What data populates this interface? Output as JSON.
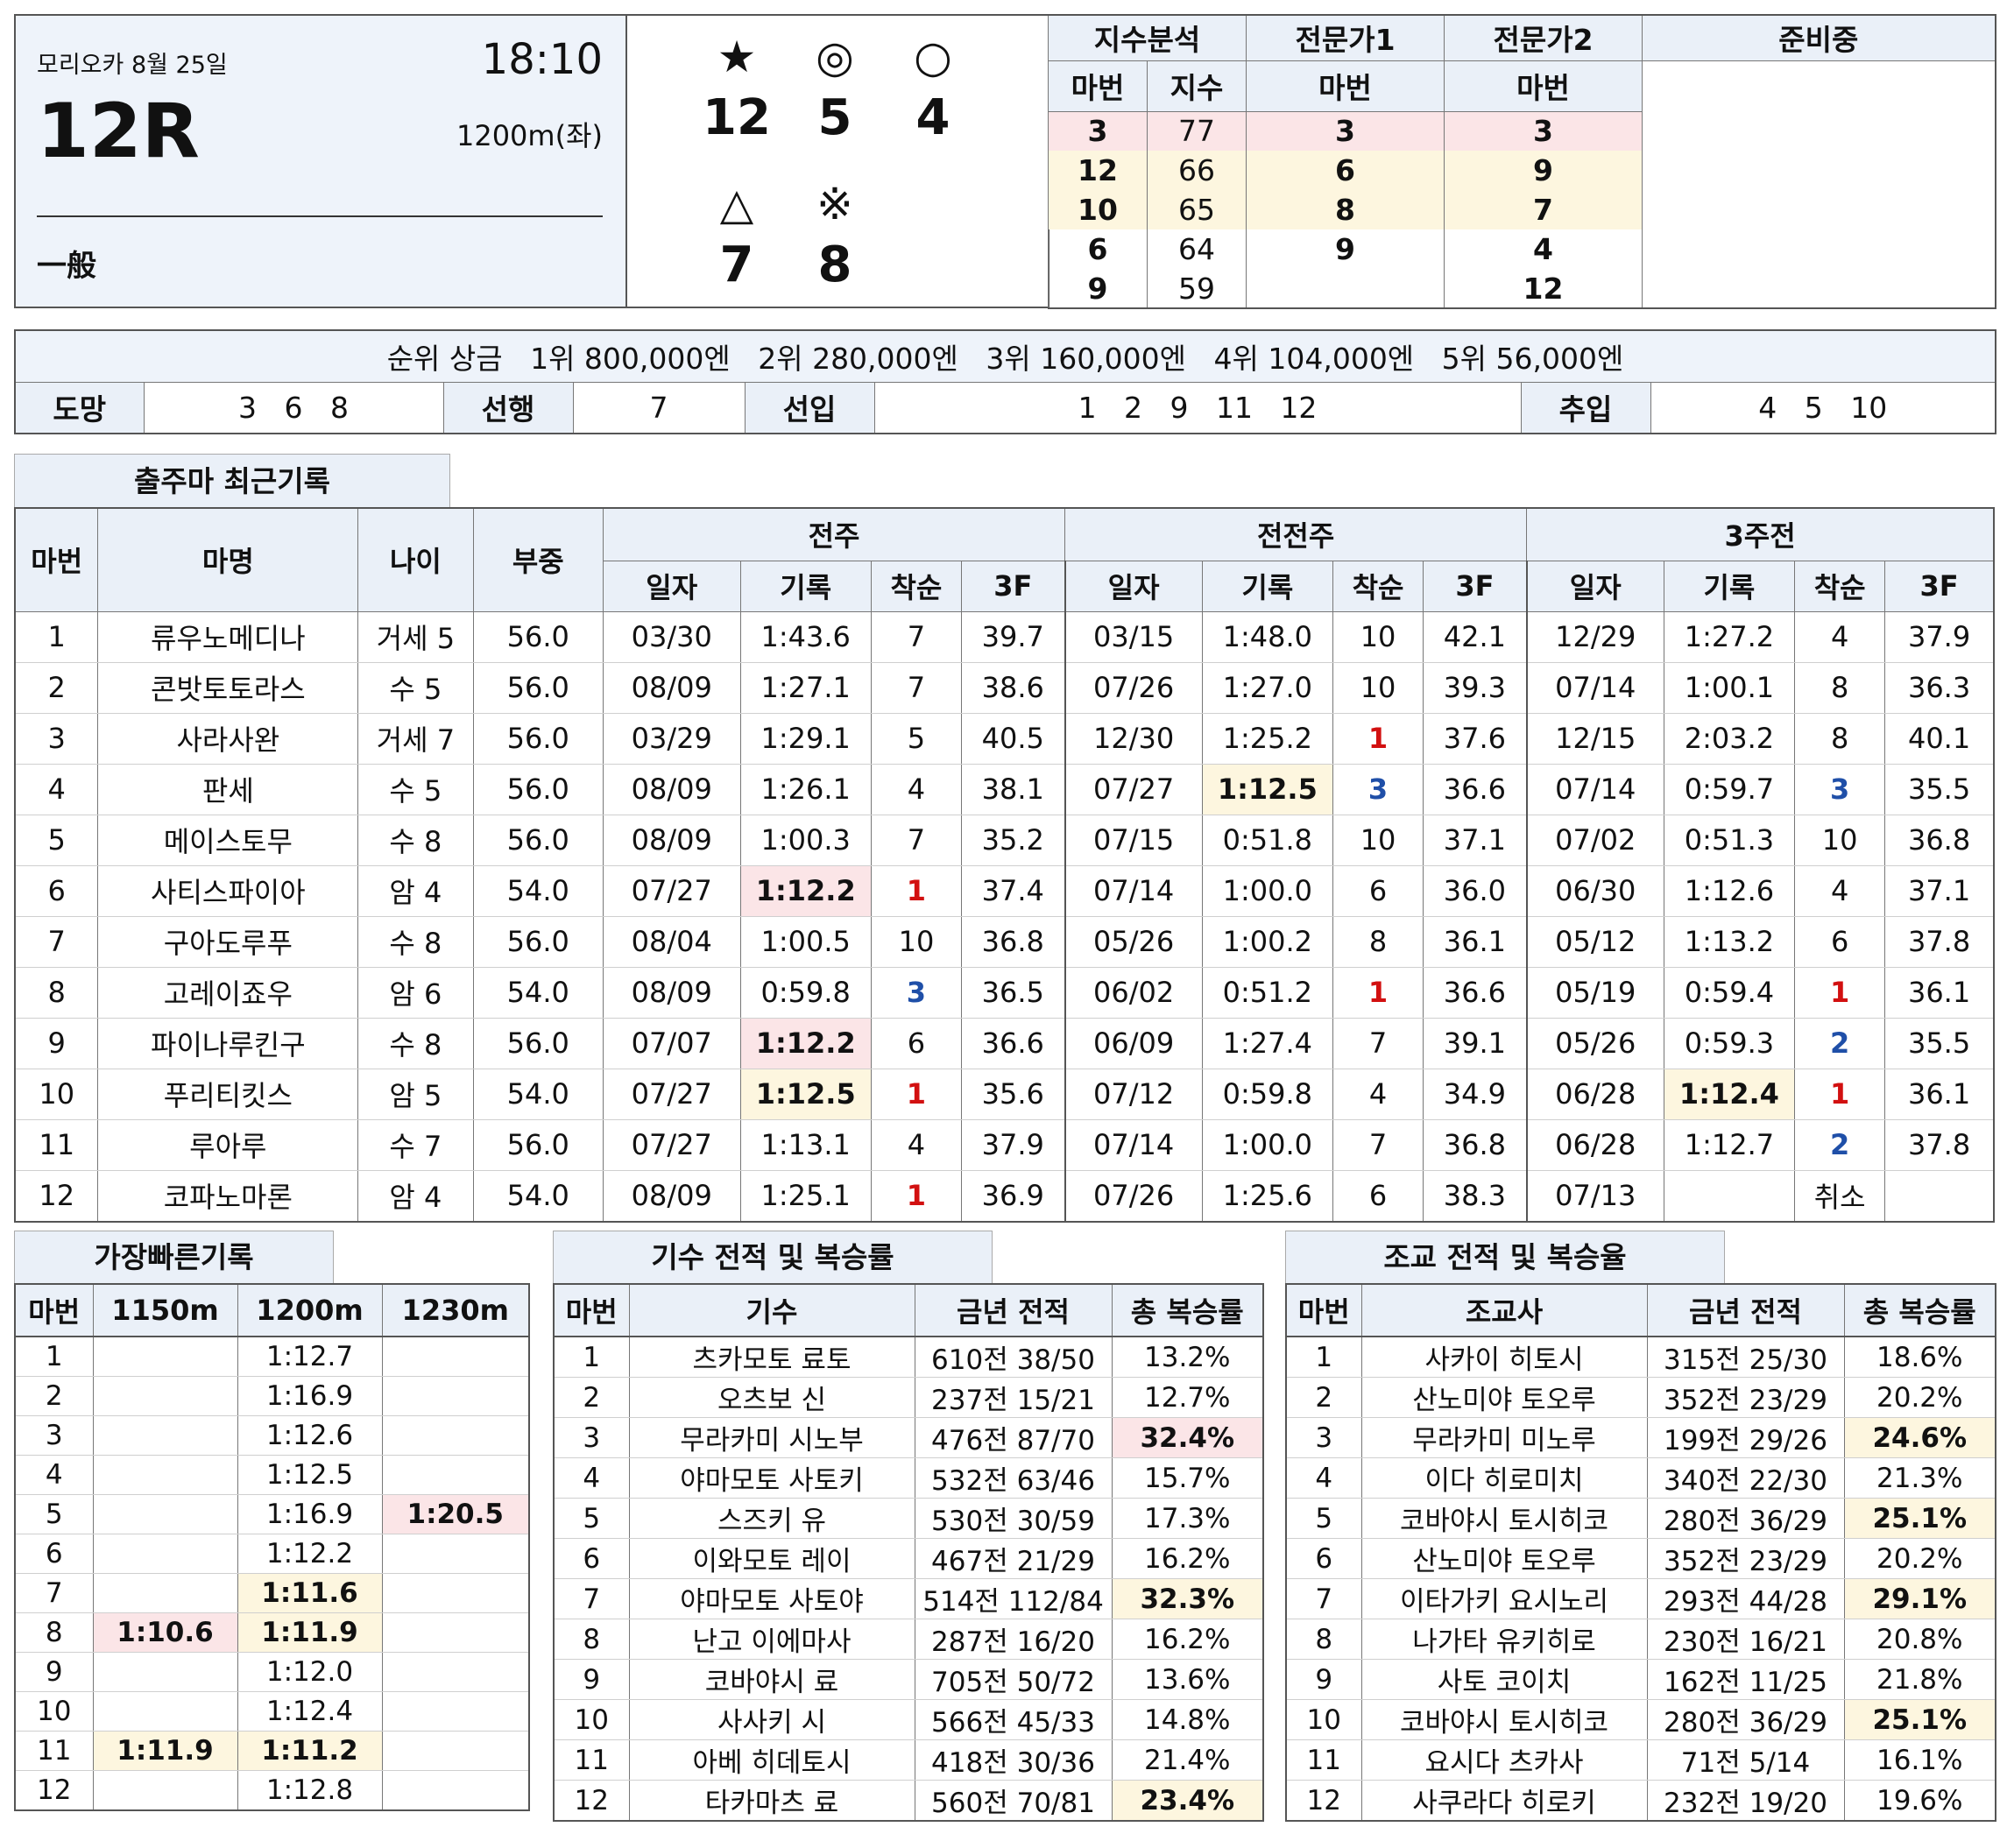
{
  "race": {
    "venue_date": "모리오카 8월 25일",
    "time": "18:10",
    "number": "12R",
    "distance": "1200m(좌)",
    "class": "一般"
  },
  "marks": [
    {
      "symbol": "★",
      "num": "12"
    },
    {
      "symbol": "◎",
      "num": "5"
    },
    {
      "symbol": "○",
      "num": "4"
    },
    {
      "symbol": "△",
      "num": "7"
    },
    {
      "symbol": "※",
      "num": "8"
    }
  ],
  "analysis": {
    "headers": [
      "지수분석",
      "전문가1",
      "전문가2",
      "준비중"
    ],
    "subheaders": [
      "마번",
      "지수",
      "마번",
      "마번"
    ],
    "rows": [
      {
        "idx_num": "3",
        "idx_val": "77",
        "exp1": "3",
        "exp2": "3"
      },
      {
        "idx_num": "12",
        "idx_val": "66",
        "exp1": "6",
        "exp2": "9"
      },
      {
        "idx_num": "10",
        "idx_val": "65",
        "exp1": "8",
        "exp2": "7"
      },
      {
        "idx_num": "6",
        "idx_val": "64",
        "exp1": "9",
        "exp2": "4"
      },
      {
        "idx_num": "9",
        "idx_val": "59",
        "exp1": "",
        "exp2": "12"
      }
    ]
  },
  "prize": {
    "text": "순위 상금   1위 800,000엔   2위 280,000엔   3위 160,000엔   4위 104,000엔   5위 56,000엔"
  },
  "style": {
    "labels": [
      "도망",
      "선행",
      "선입",
      "추입"
    ],
    "values": [
      "3   6   8",
      "7",
      "1   2   9   11   12",
      "4   5   10"
    ]
  },
  "recent": {
    "title": "출주마 최근기록",
    "headers": [
      "마번",
      "마명",
      "나이",
      "부중"
    ],
    "groups": [
      "전주",
      "전전주",
      "3주전"
    ],
    "sub": [
      "일자",
      "기록",
      "착순",
      "3F"
    ],
    "rows": [
      {
        "num": "1",
        "name": "류우노메디나",
        "age": "거세 5",
        "wt": "56.0",
        "r": [
          [
            "03/30",
            "1:43.6",
            "7",
            "39.7"
          ],
          [
            "03/15",
            "1:48.0",
            "10",
            "42.1"
          ],
          [
            "12/29",
            "1:27.2",
            "4",
            "37.9"
          ]
        ]
      },
      {
        "num": "2",
        "name": "콘밧토토라스",
        "age": "수 5",
        "wt": "56.0",
        "r": [
          [
            "08/09",
            "1:27.1",
            "7",
            "38.6"
          ],
          [
            "07/26",
            "1:27.0",
            "10",
            "39.3"
          ],
          [
            "07/14",
            "1:00.1",
            "8",
            "36.3"
          ]
        ]
      },
      {
        "num": "3",
        "name": "사라사완",
        "age": "거세 7",
        "wt": "56.0",
        "r": [
          [
            "03/29",
            "1:29.1",
            "5",
            "40.5"
          ],
          [
            "12/30",
            "1:25.2",
            "1",
            "37.6"
          ],
          [
            "12/15",
            "2:03.2",
            "8",
            "40.1"
          ]
        ]
      },
      {
        "num": "4",
        "name": "판세",
        "age": "수 5",
        "wt": "56.0",
        "r": [
          [
            "08/09",
            "1:26.1",
            "4",
            "38.1"
          ],
          [
            "07/27",
            "1:12.5",
            "3",
            "36.6"
          ],
          [
            "07/14",
            "0:59.7",
            "3",
            "35.5"
          ]
        ]
      },
      {
        "num": "5",
        "name": "메이스토무",
        "age": "수 8",
        "wt": "56.0",
        "r": [
          [
            "08/09",
            "1:00.3",
            "7",
            "35.2"
          ],
          [
            "07/15",
            "0:51.8",
            "10",
            "37.1"
          ],
          [
            "07/02",
            "0:51.3",
            "10",
            "36.8"
          ]
        ]
      },
      {
        "num": "6",
        "name": "사티스파이아",
        "age": "암 4",
        "wt": "54.0",
        "r": [
          [
            "07/27",
            "1:12.2",
            "1",
            "37.4"
          ],
          [
            "07/14",
            "1:00.0",
            "6",
            "36.0"
          ],
          [
            "06/30",
            "1:12.6",
            "4",
            "37.1"
          ]
        ]
      },
      {
        "num": "7",
        "name": "구아도루푸",
        "age": "수 8",
        "wt": "56.0",
        "r": [
          [
            "08/04",
            "1:00.5",
            "10",
            "36.8"
          ],
          [
            "05/26",
            "1:00.2",
            "8",
            "36.1"
          ],
          [
            "05/12",
            "1:13.2",
            "6",
            "37.8"
          ]
        ]
      },
      {
        "num": "8",
        "name": "고레이죠우",
        "age": "암 6",
        "wt": "54.0",
        "r": [
          [
            "08/09",
            "0:59.8",
            "3",
            "36.5"
          ],
          [
            "06/02",
            "0:51.2",
            "1",
            "36.6"
          ],
          [
            "05/19",
            "0:59.4",
            "1",
            "36.1"
          ]
        ]
      },
      {
        "num": "9",
        "name": "파이나루킨구",
        "age": "수 8",
        "wt": "56.0",
        "r": [
          [
            "07/07",
            "1:12.2",
            "6",
            "36.6"
          ],
          [
            "06/09",
            "1:27.4",
            "7",
            "39.1"
          ],
          [
            "05/26",
            "0:59.3",
            "2",
            "35.5"
          ]
        ]
      },
      {
        "num": "10",
        "name": "푸리티킷스",
        "age": "암 5",
        "wt": "54.0",
        "r": [
          [
            "07/27",
            "1:12.5",
            "1",
            "35.6"
          ],
          [
            "07/12",
            "0:59.8",
            "4",
            "34.9"
          ],
          [
            "06/28",
            "1:12.4",
            "1",
            "36.1"
          ]
        ]
      },
      {
        "num": "11",
        "name": "루아루",
        "age": "수 7",
        "wt": "56.0",
        "r": [
          [
            "07/27",
            "1:13.1",
            "4",
            "37.9"
          ],
          [
            "07/14",
            "1:00.0",
            "7",
            "36.8"
          ],
          [
            "06/28",
            "1:12.7",
            "2",
            "37.8"
          ]
        ]
      },
      {
        "num": "12",
        "name": "코파노마론",
        "age": "암 4",
        "wt": "54.0",
        "r": [
          [
            "08/09",
            "1:25.1",
            "1",
            "36.9"
          ],
          [
            "07/26",
            "1:25.6",
            "6",
            "38.3"
          ],
          [
            "07/13",
            "",
            "취소",
            ""
          ]
        ]
      }
    ]
  },
  "fastest": {
    "title": "가장빠른기록",
    "headers": [
      "마번",
      "1150m",
      "1200m",
      "1230m"
    ],
    "rows": [
      [
        "1",
        "",
        "1:12.7",
        ""
      ],
      [
        "2",
        "",
        "1:16.9",
        ""
      ],
      [
        "3",
        "",
        "1:12.6",
        ""
      ],
      [
        "4",
        "",
        "1:12.5",
        ""
      ],
      [
        "5",
        "",
        "1:16.9",
        "1:20.5"
      ],
      [
        "6",
        "",
        "1:12.2",
        ""
      ],
      [
        "7",
        "",
        "1:11.6",
        ""
      ],
      [
        "8",
        "1:10.6",
        "1:11.9",
        ""
      ],
      [
        "9",
        "",
        "1:12.0",
        ""
      ],
      [
        "10",
        "",
        "1:12.4",
        ""
      ],
      [
        "11",
        "1:11.9",
        "1:11.2",
        ""
      ],
      [
        "12",
        "",
        "1:12.8",
        ""
      ]
    ]
  },
  "jockey": {
    "title": "기수 전적 및 복승률",
    "headers": [
      "마번",
      "기수",
      "금년 전적",
      "총 복승률"
    ],
    "rows": [
      [
        "1",
        "츠카모토 료토",
        "610전 38/50",
        "13.2%"
      ],
      [
        "2",
        "오츠보 신",
        "237전 15/21",
        "12.7%"
      ],
      [
        "3",
        "무라카미 시노부",
        "476전 87/70",
        "32.4%"
      ],
      [
        "4",
        "야마모토 사토키",
        "532전 63/46",
        "15.7%"
      ],
      [
        "5",
        "스즈키 유",
        "530전 30/59",
        "17.3%"
      ],
      [
        "6",
        "이와모토 레이",
        "467전 21/29",
        "16.2%"
      ],
      [
        "7",
        "야마모토 사토야",
        "514전 112/84",
        "32.3%"
      ],
      [
        "8",
        "난고 이에마사",
        "287전 16/20",
        "16.2%"
      ],
      [
        "9",
        "코바야시 료",
        "705전 50/72",
        "13.6%"
      ],
      [
        "10",
        "사사키 시",
        "566전 45/33",
        "14.8%"
      ],
      [
        "11",
        "아베 히데토시",
        "418전 30/36",
        "21.4%"
      ],
      [
        "12",
        "타카마츠 료",
        "560전 70/81",
        "23.4%"
      ]
    ]
  },
  "trainer": {
    "title": "조교 전적 및 복승율",
    "headers": [
      "마번",
      "조교사",
      "금년 전적",
      "총 복승률"
    ],
    "rows": [
      [
        "1",
        "사카이 히토시",
        "315전 25/30",
        "18.6%"
      ],
      [
        "2",
        "산노미야 토오루",
        "352전 23/29",
        "20.2%"
      ],
      [
        "3",
        "무라카미 미노루",
        "199전 29/26",
        "24.6%"
      ],
      [
        "4",
        "이다 히로미치",
        "340전 22/30",
        "21.3%"
      ],
      [
        "5",
        "코바야시 토시히코",
        "280전 36/29",
        "25.1%"
      ],
      [
        "6",
        "산노미야 토오루",
        "352전 23/29",
        "20.2%"
      ],
      [
        "7",
        "이타가키 요시노리",
        "293전 44/28",
        "29.1%"
      ],
      [
        "8",
        "나가타 유키히로",
        "230전 16/21",
        "20.8%"
      ],
      [
        "9",
        "사토 코이치",
        "162전 11/25",
        "21.8%"
      ],
      [
        "10",
        "코바야시 토시히코",
        "280전 36/29",
        "25.1%"
      ],
      [
        "11",
        "요시다 츠카사",
        "71전 5/14",
        "16.1%"
      ],
      [
        "12",
        "사쿠라다 히로키",
        "232전 19/20",
        "19.6%"
      ]
    ]
  }
}
